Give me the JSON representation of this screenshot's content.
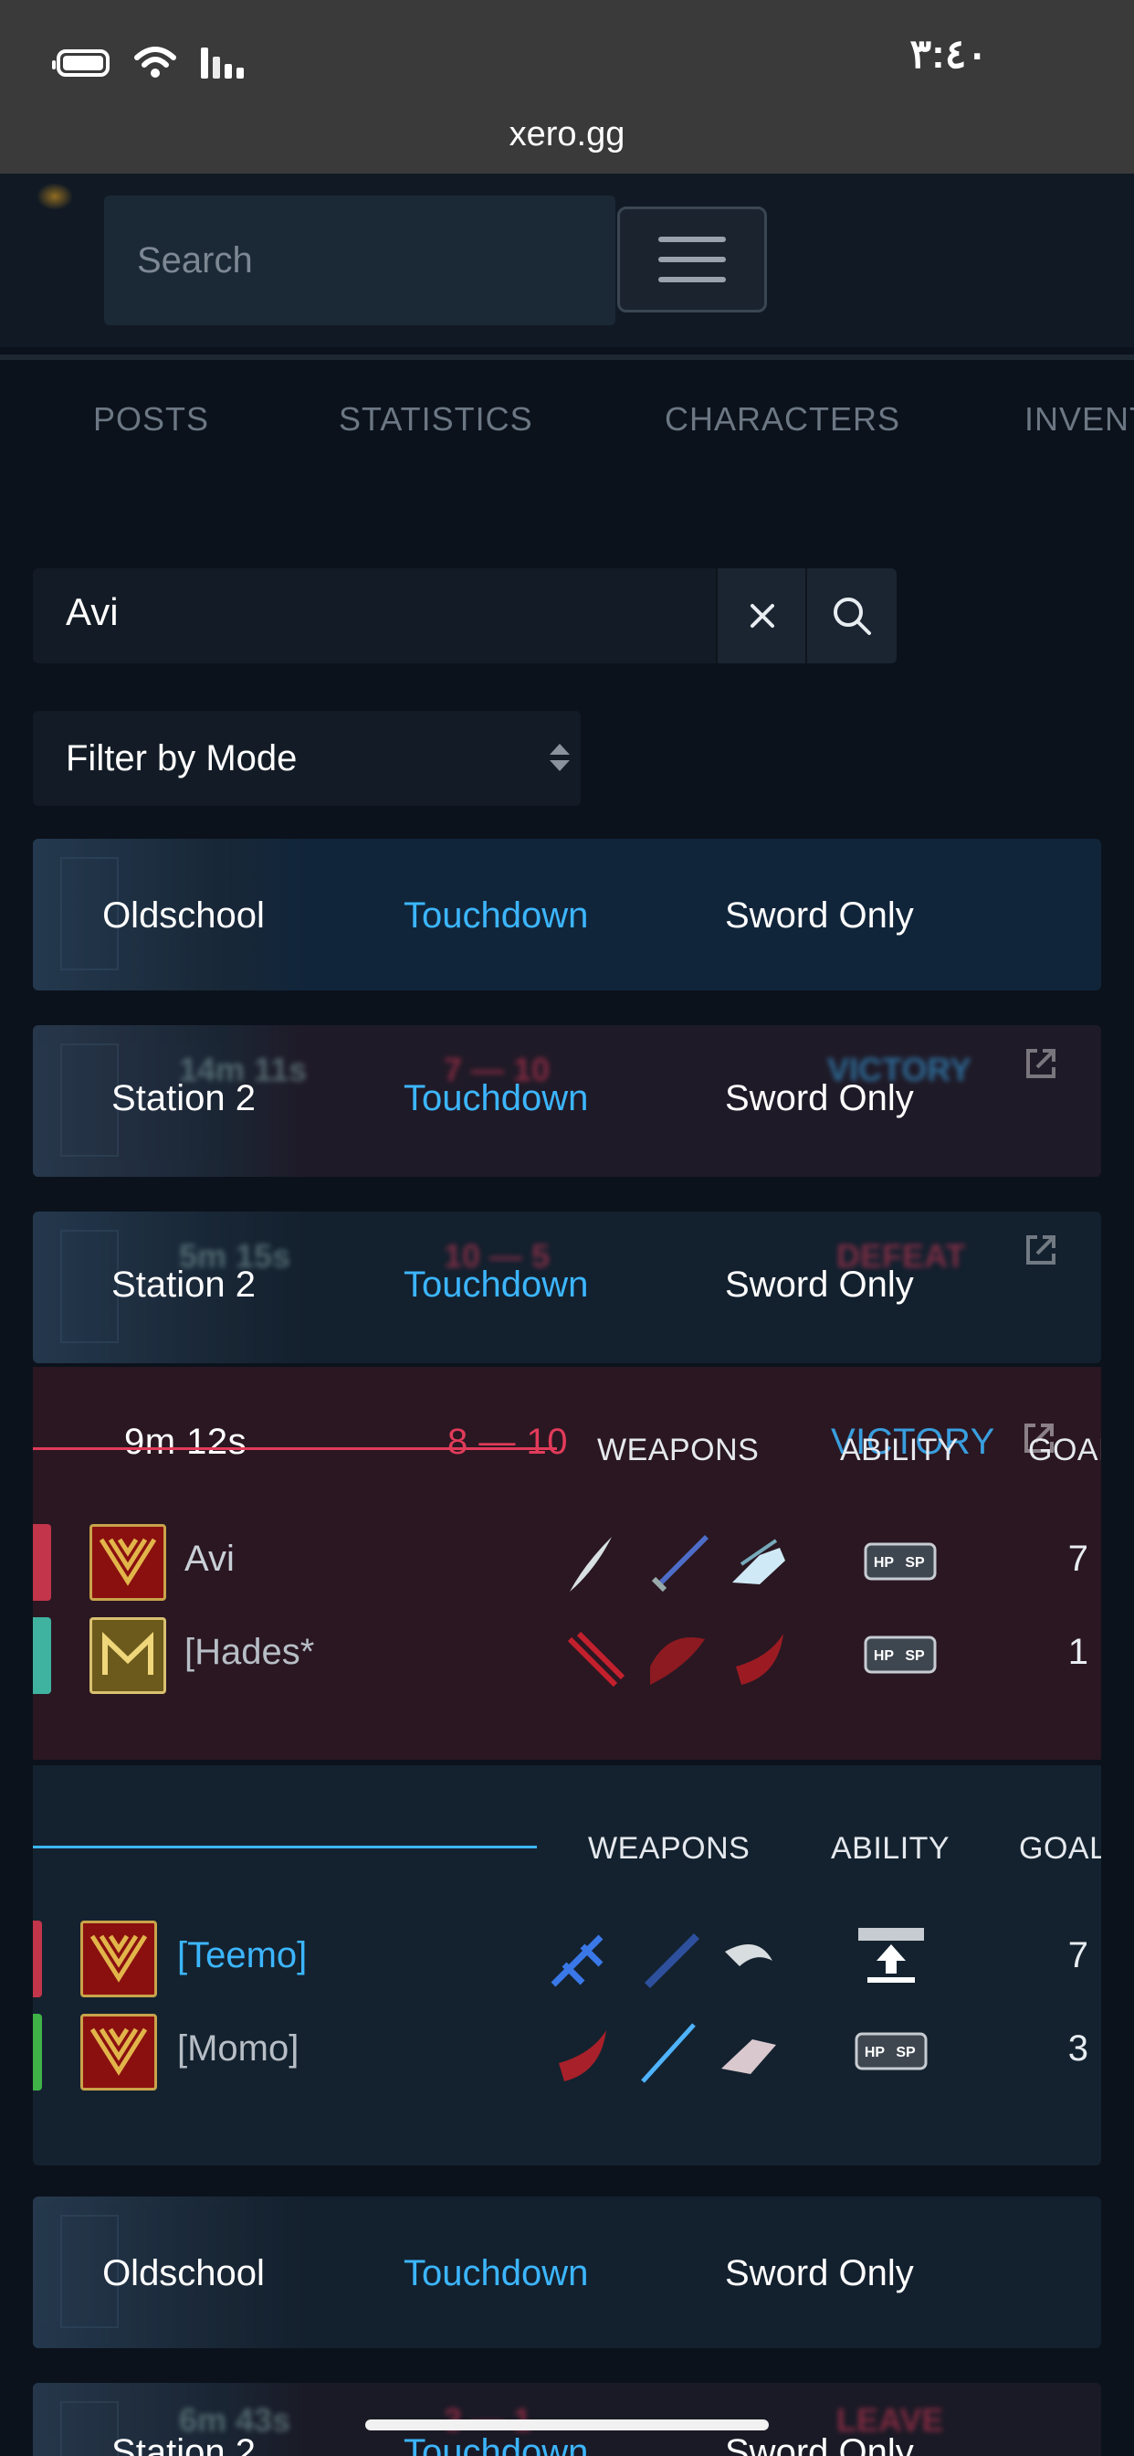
{
  "status_bar": {
    "time": "٣:٤٠",
    "url": "xero.gg"
  },
  "header": {
    "search_placeholder": "Search",
    "menu_icon": "hamburger-menu-icon"
  },
  "tabs": [
    "POSTS",
    "STATISTICS",
    "CHARACTERS",
    "INVENT"
  ],
  "filters": {
    "search_value": "Avi",
    "mode_select": "Filter by Mode"
  },
  "matches_top": [
    {
      "map": "Oldschool",
      "mode": "Touchdown",
      "rule": "Sword Only",
      "duration": "",
      "score": "",
      "result": ""
    },
    {
      "map": "Station 2",
      "mode": "Touchdown",
      "rule": "Sword Only",
      "duration": "14m 11s",
      "score": "7 — 10",
      "result": "VICTORY"
    },
    {
      "map": "Station 2",
      "mode": "Touchdown",
      "rule": "Sword Only",
      "duration": "5m 15s",
      "score": "10 — 5",
      "result": "DEFEAT"
    }
  ],
  "expanded_match": {
    "duration": "9m 12s",
    "score": "8 — 10",
    "result": "VICTORY",
    "columns": {
      "weapons": "WEAPONS",
      "ability": "ABILITY",
      "goal": "GOAL",
      "goal_partial": "GOAl"
    },
    "red_team": [
      {
        "name": "Avi",
        "goals": "7",
        "ability": "HP/SP"
      },
      {
        "name": "[Hades*",
        "goals": "1",
        "ability": "HP/SP"
      }
    ],
    "blue_team": [
      {
        "name": "[Teemo]",
        "goals": "7",
        "ability": "SP"
      },
      {
        "name": "[Momo]",
        "goals": "3",
        "ability": "HP/SP"
      }
    ]
  },
  "matches_bottom": [
    {
      "map": "Oldschool",
      "mode": "Touchdown",
      "rule": "Sword Only",
      "duration": "",
      "result": ""
    },
    {
      "map": "Station 2",
      "mode": "Touchdown",
      "rule": "Sword Only",
      "duration": "6m 43s",
      "score": "3 — 1",
      "result": "LEAVE"
    }
  ],
  "colors": {
    "accent_blue": "#3cb6ff",
    "red": "#e23b5a",
    "bg": "#0b121c"
  }
}
